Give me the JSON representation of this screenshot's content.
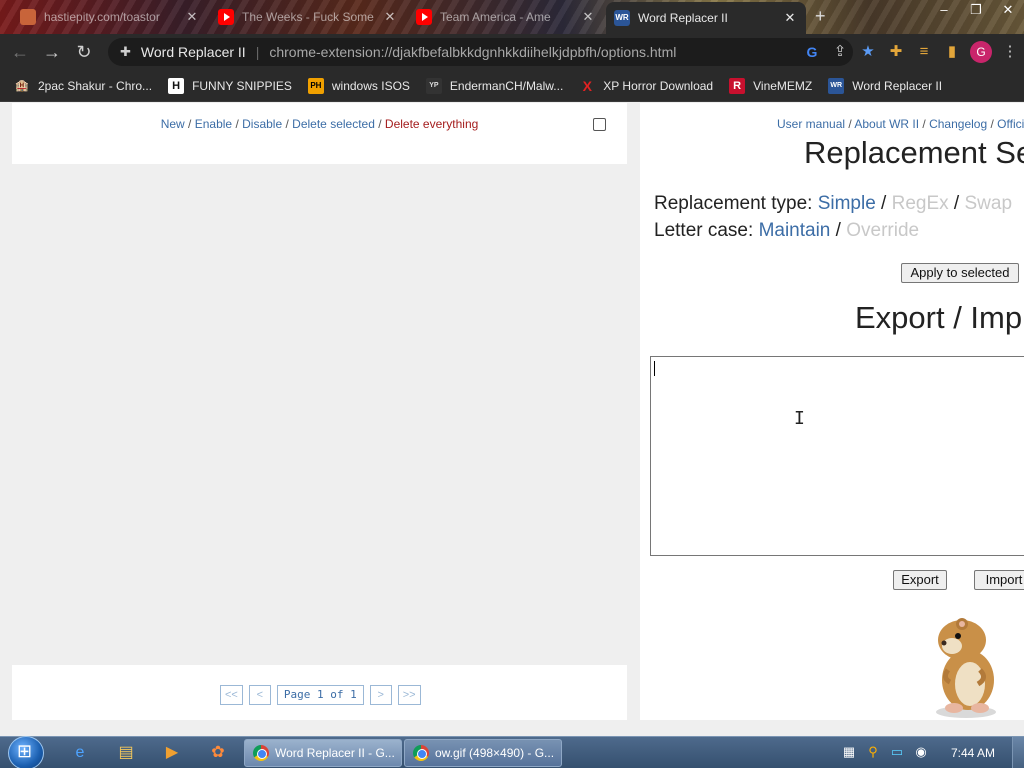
{
  "browser": {
    "tabs": [
      {
        "title": "hastiepity.com/toastor",
        "favicon": "spiral-icon",
        "active": false
      },
      {
        "title": "The Weeks - Fuck Some",
        "favicon": "youtube-icon",
        "active": false
      },
      {
        "title": "Team America - Ame",
        "favicon": "youtube-icon",
        "active": false
      },
      {
        "title": "Word Replacer II",
        "favicon": "wr-icon",
        "active": true
      }
    ],
    "new_tab_symbol": "+",
    "window_controls": {
      "minimize": "–",
      "maximize": "❐",
      "close": "✕"
    },
    "address": {
      "ext_label": "Word Replacer II",
      "separator": "|",
      "url": "chrome-extension://djakfbefalbkkdgnhkkdiihelkjdpbfh/options.html"
    },
    "avatar_letter": "G",
    "bookmarks": [
      {
        "label": "2pac Shakur - Chro...",
        "icon": "hotel-icon",
        "icon_text": "🏨",
        "color": "#e87a4a"
      },
      {
        "label": "FUNNY SNIPPIES",
        "icon": "h-icon",
        "icon_text": "H",
        "color": "#ffffff"
      },
      {
        "label": "windows ISOS",
        "icon": "ph-icon",
        "icon_text": "PH",
        "color": "#f0a000"
      },
      {
        "label": "EndermanCH/Malw...",
        "icon": "yp-icon",
        "icon_text": "YP",
        "color": "#555555"
      },
      {
        "label": "XP Horror Download",
        "icon": "x-icon",
        "icon_text": "X",
        "color": "#e22222"
      },
      {
        "label": "VineMEMZ",
        "icon": "r-icon",
        "icon_text": "R",
        "color": "#c8102e"
      },
      {
        "label": "Word Replacer II",
        "icon": "wr-icon",
        "icon_text": "WR",
        "color": "#2b5597"
      }
    ]
  },
  "list_panel": {
    "actions": {
      "new": "New",
      "sep": " / ",
      "enable": "Enable",
      "disable": "Disable",
      "delete_selected": "Delete selected",
      "delete_everything": "Delete everything"
    },
    "pager": {
      "first": "<<",
      "prev": "<",
      "page_indicator": "Page 1 of 1",
      "next": ">",
      "last": ">>"
    }
  },
  "settings_panel": {
    "links": {
      "user_manual": "User manual",
      "about": "About WR II",
      "changelog": "Changelog",
      "official": "Offici",
      "sep": " / "
    },
    "title": "Replacement Se",
    "replacement_type": {
      "label": "Replacement type: ",
      "simple": "Simple",
      "regex": "RegEx",
      "swap": "Swap",
      "sep": " / "
    },
    "letter_case": {
      "label": "Letter case: ",
      "maintain": "Maintain",
      "override": "Override",
      "sep": " / "
    },
    "apply_button": "Apply to selected",
    "export_title": "Export / Imp",
    "textarea_value": "",
    "export_button": "Export",
    "import_button": "Import"
  },
  "taskbar": {
    "tasks": [
      {
        "label": "Word Replacer II - G...",
        "active": true
      },
      {
        "label": "ow.gif (498×490) - G...",
        "active": false
      }
    ],
    "clock": "7:44 AM"
  },
  "colors": {
    "link_blue": "#3c6da6",
    "danger_red": "#a41d1d",
    "disabled_gray": "#c8c8c8",
    "browser_dark": "#2a2a2a",
    "avatar_pink": "#c9256b"
  }
}
